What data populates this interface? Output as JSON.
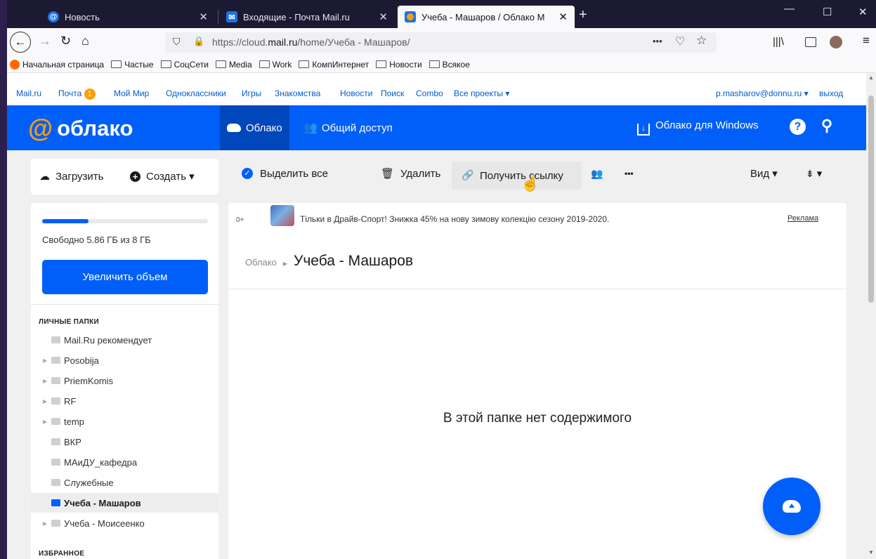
{
  "tabs": [
    {
      "title": "Новость",
      "active": false
    },
    {
      "title": "Входящие - Почта Mail.ru",
      "active": false
    },
    {
      "title": "Учеба - Машаров / Облако М",
      "active": true
    }
  ],
  "window_controls": {
    "minimize": "—",
    "maximize": "☐",
    "close": "✕"
  },
  "url": {
    "prefix": "https://cloud.",
    "domain": "mail.ru",
    "path": "/home/Учеба - Машаров/",
    "dots": "•••"
  },
  "bookmarks": [
    "Начальная страница",
    "Частые",
    "СоцСети",
    "Media",
    "Work",
    "КомпИнтернет",
    "Новости",
    "Всякое"
  ],
  "portal": {
    "links": [
      "Mail.ru",
      "Почта",
      "Мой Мир",
      "Одноклассники",
      "Игры",
      "Знакомства",
      "Новости",
      "Поиск",
      "Combo",
      "Все проекты ▾"
    ],
    "mail_badge": "1",
    "user": "p.masharov@donnu.ru ▾",
    "logout": "выход"
  },
  "header": {
    "logo": "облако",
    "nav": [
      "Облако",
      "Общий доступ"
    ],
    "windows_link": "Облако для Windows",
    "brand_color": "#005ff9"
  },
  "toolbar": {
    "upload": "Загрузить",
    "create": "Создать ▾",
    "select_all": "Выделить все",
    "delete": "Удалить",
    "get_link": "Получить ссылку",
    "more": "•••",
    "view": "Вид ▾",
    "sort": "▾"
  },
  "sidebar": {
    "quota_fraction": 0.28,
    "quota_text": "Свободно 5.86 ГБ из 8 ГБ",
    "increase_button": "Увеличить объем",
    "personal_header": "ЛИЧНЫЕ ПАПКИ",
    "folders": [
      {
        "name": "Mail.Ru рекомендует",
        "arrow": false,
        "selected": false
      },
      {
        "name": "Posobija",
        "arrow": true,
        "selected": false
      },
      {
        "name": "PriemKomis",
        "arrow": true,
        "selected": false
      },
      {
        "name": "RF",
        "arrow": true,
        "selected": false
      },
      {
        "name": "temp",
        "arrow": true,
        "selected": false
      },
      {
        "name": "ВКР",
        "arrow": false,
        "selected": false
      },
      {
        "name": "МАиДУ_кафедра",
        "arrow": false,
        "selected": false
      },
      {
        "name": "Служебные",
        "arrow": false,
        "selected": false
      },
      {
        "name": "Учеба - Машаров",
        "arrow": false,
        "selected": true
      },
      {
        "name": "Учеба - Моисеенко",
        "arrow": true,
        "selected": false
      }
    ],
    "favorites_header": "ИЗБРАННОЕ"
  },
  "ad": {
    "age": "0+",
    "text": "Тільки в Драйв-Спорт!   Знижка 45% на нову зимову колекцію сезону 2019-2020.",
    "label": "Реклама"
  },
  "breadcrumb": {
    "root": "Облако",
    "current": "Учеба - Машаров"
  },
  "empty_message": "В этой папке нет содержимого"
}
